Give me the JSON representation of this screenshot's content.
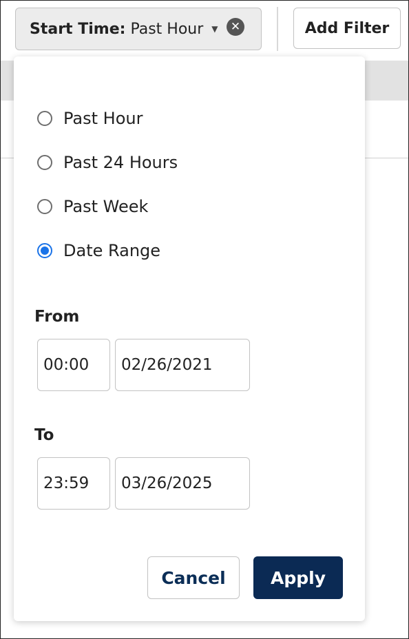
{
  "filter_chip": {
    "label": "Start Time:",
    "value": "Past Hour",
    "caret_icon": "caret-down-icon",
    "clear_icon": "close-circle-icon"
  },
  "add_filter_label": "Add Filter",
  "options": [
    {
      "label": "Past Hour",
      "checked": false
    },
    {
      "label": "Past 24 Hours",
      "checked": false
    },
    {
      "label": "Past Week",
      "checked": false
    },
    {
      "label": "Date Range",
      "checked": true
    }
  ],
  "from": {
    "label": "From",
    "time": "00:00",
    "date": "02/26/2021"
  },
  "to": {
    "label": "To",
    "time": "23:59",
    "date": "03/26/2025"
  },
  "buttons": {
    "cancel": "Cancel",
    "apply": "Apply"
  },
  "colors": {
    "accent": "#1a73e8",
    "primary_button": "#0b2a54"
  }
}
